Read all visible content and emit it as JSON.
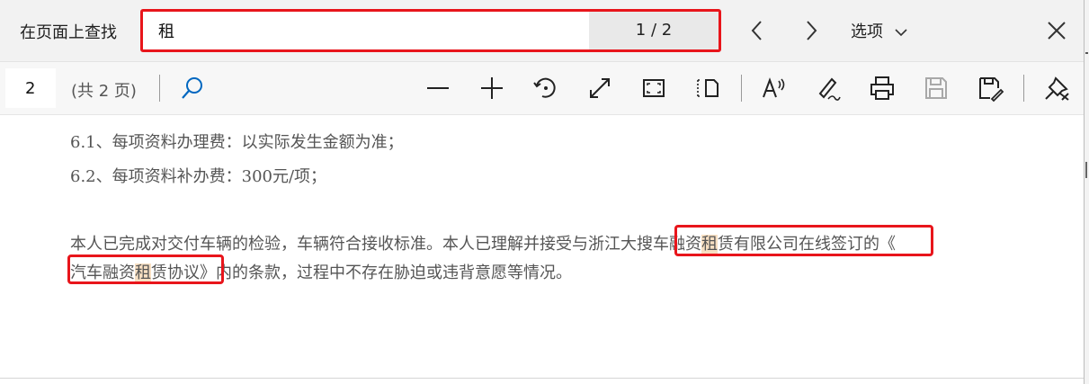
{
  "find_bar": {
    "label": "在页面上查找",
    "query": "租",
    "match_count": "1 / 2",
    "options_label": "选项",
    "prev_icon": "chevron-left-icon",
    "next_icon": "chevron-right-icon",
    "close_icon": "close-icon"
  },
  "pdf_toolbar": {
    "page_number": "2",
    "page_total": "(共 2 页)",
    "icons": [
      "search-icon",
      "zoom-out-icon",
      "zoom-in-icon",
      "rotate-icon",
      "fit-page-icon",
      "fullscreen-icon",
      "page-view-icon",
      "read-aloud-icon",
      "draw-icon",
      "print-icon",
      "save-icon",
      "save-as-icon",
      "pin-toolbar-icon"
    ]
  },
  "document": {
    "line1": "6.1、每项资料办理费：以实际发生金额为准；",
    "line2": "6.2、每项资料补办费：300元/项；",
    "para_line1_a": "本人已完成对交付车辆的检验，车辆符合接收标准。本人已理解并接受与",
    "company_a": "浙江大搜车融资",
    "company_hit": "租",
    "company_b": "赁有限公司",
    "para_line1_b": "在线签订的《",
    "agreement_a": "汽车融资",
    "agreement_hit": "租",
    "agreement_b": "赁协议",
    "para_line2_rest": "》内的条款，过程中不存在胁迫或违背意愿等情况。"
  },
  "colors": {
    "annotation_box": "#e8151b",
    "match_highlight": "#f7dfc2",
    "findbar_bg": "#f2f2f2",
    "toolbar_bg": "#f7f7f7",
    "search_accent": "#0067c0"
  }
}
